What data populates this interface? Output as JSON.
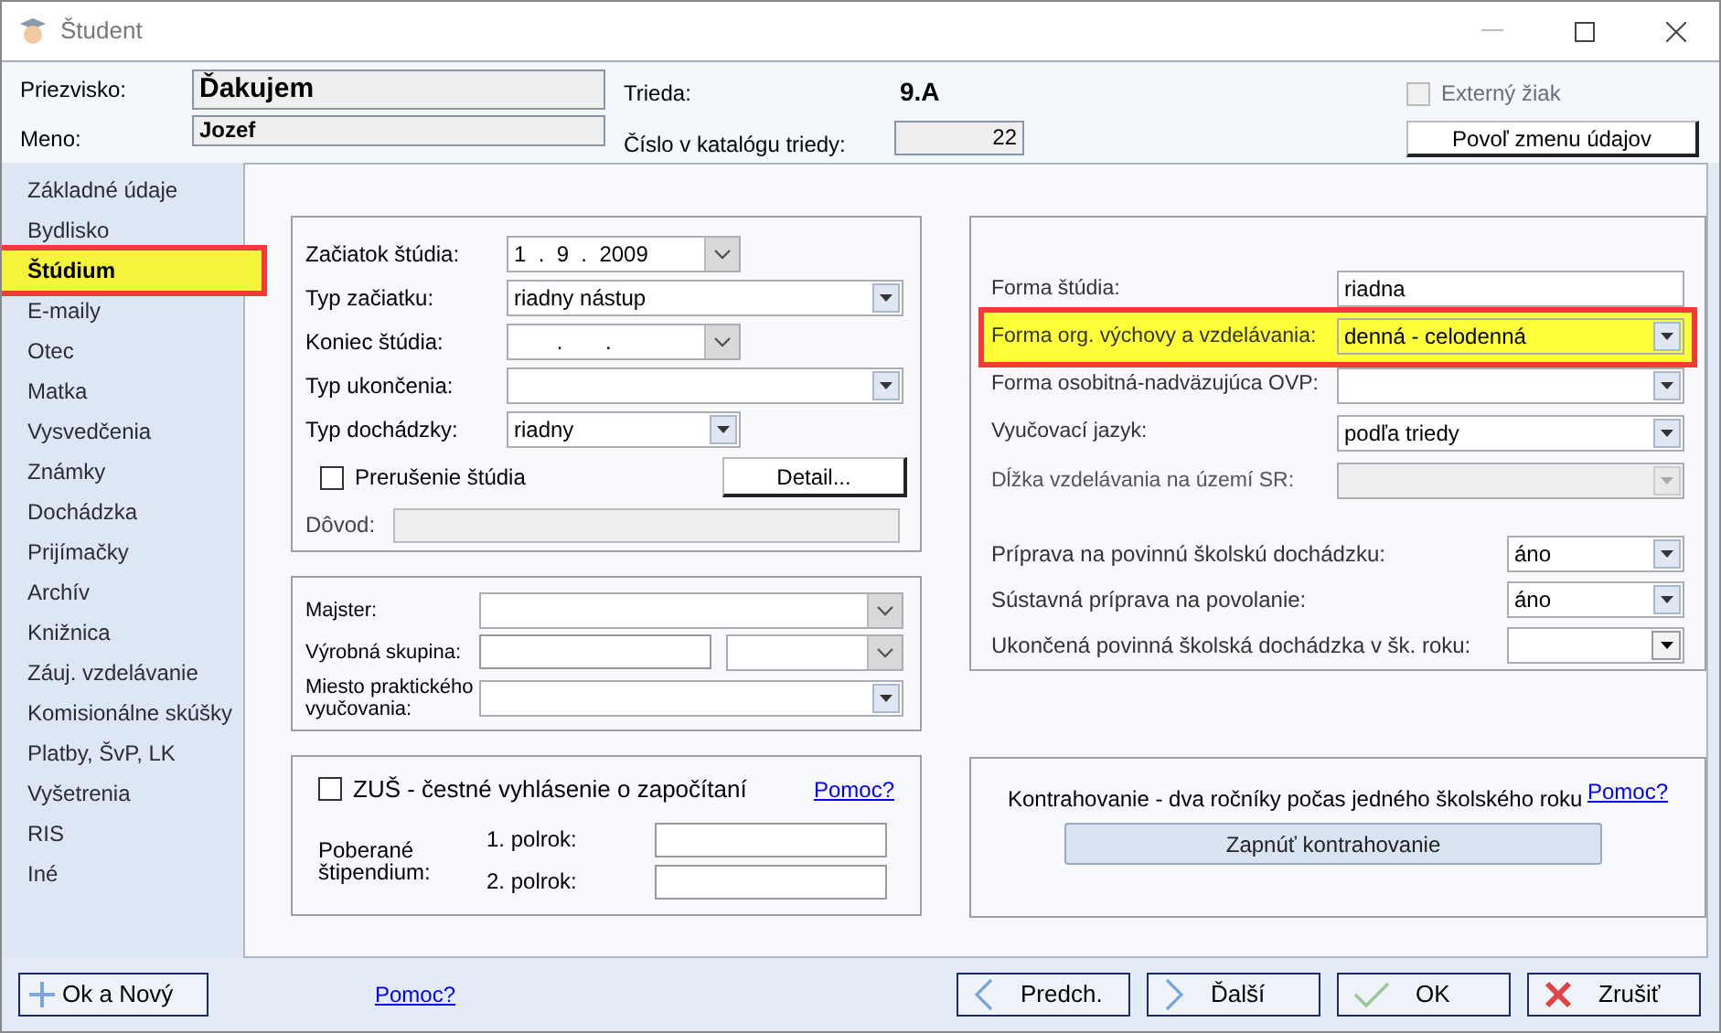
{
  "window": {
    "title": "Študent"
  },
  "header": {
    "surname_label": "Priezvisko:",
    "surname": "Ďakujem",
    "name_label": "Meno:",
    "name": "Jozef",
    "class_label": "Trieda:",
    "class": "9.A",
    "catalog_label": "Číslo v katalógu triedy:",
    "catalog_number": "22",
    "external": {
      "label": "Externý žiak",
      "checked": false,
      "disabled": true
    },
    "allow_edit_button": "Povoľ zmenu údajov"
  },
  "sidebar": {
    "items": [
      {
        "label": "Základné údaje",
        "selected": false
      },
      {
        "label": "Bydlisko",
        "selected": false
      },
      {
        "label": "Štúdium",
        "selected": true
      },
      {
        "label": "E-maily",
        "selected": false
      },
      {
        "label": "Otec",
        "selected": false
      },
      {
        "label": "Matka",
        "selected": false
      },
      {
        "label": "Vysvedčenia",
        "selected": false
      },
      {
        "label": "Známky",
        "selected": false
      },
      {
        "label": "Dochádzka",
        "selected": false
      },
      {
        "label": "Prijímačky",
        "selected": false
      },
      {
        "label": "Archív",
        "selected": false
      },
      {
        "label": "Knižnica",
        "selected": false
      },
      {
        "label": "Záuj. vzdelávanie",
        "selected": false
      },
      {
        "label": "Komisionálne skúšky",
        "selected": false
      },
      {
        "label": "Platby, ŠvP, LK",
        "selected": false
      },
      {
        "label": "Vyšetrenia",
        "selected": false
      },
      {
        "label": "RIS",
        "selected": false
      },
      {
        "label": "Iné",
        "selected": false
      }
    ]
  },
  "study_group": {
    "fields": [
      {
        "label": "Začiatok štúdia:",
        "kind": "date",
        "value": "1  .  9  .  2009"
      },
      {
        "label": "Typ začiatku:",
        "kind": "combo",
        "value": "riadny nástup"
      },
      {
        "label": "Koniec štúdia:",
        "kind": "date",
        "value": "       .       ."
      },
      {
        "label": "Typ ukončenia:",
        "kind": "combo"
      },
      {
        "label": "Typ dochádzky:",
        "kind": "combo",
        "value": "riadny"
      }
    ],
    "interruption": {
      "label": "Prerušenie štúdia",
      "checked": false
    },
    "detail_button": "Detail...",
    "reason": {
      "label": "Dôvod:"
    }
  },
  "practice_group": {
    "fields": [
      {
        "label": "Majster:",
        "kind": "date"
      },
      {
        "label": "Výrobná skupina:",
        "kind": "split"
      },
      {
        "label": "Miesto praktického vyučovania:",
        "kind": "combo"
      }
    ]
  },
  "zus_group": {
    "declaration": {
      "label": "ZUŠ - čestné vyhlásenie o započítaní",
      "checked": false
    },
    "help_link": "Pomoc?",
    "stipend_label": "Poberané štipendium:",
    "terms": [
      {
        "label": "1. polrok:"
      },
      {
        "label": "2. polrok:"
      }
    ]
  },
  "form_group": {
    "fields": [
      {
        "label": "Forma štúdia:",
        "kind": "text",
        "value": "riadna",
        "highlighted": false,
        "disabled": false
      },
      {
        "label": "Forma org. výchovy a vzdelávania:",
        "kind": "combo",
        "value": "denná - celodenná",
        "highlighted": true,
        "disabled": false
      },
      {
        "label": "Forma osobitná-nadväzujúca OVP:",
        "kind": "combo",
        "highlighted": false,
        "disabled": false
      },
      {
        "label": "Vyučovací jazyk:",
        "kind": "combo",
        "value": "podľa triedy",
        "highlighted": false,
        "disabled": false
      },
      {
        "label": "Dĺžka vzdelávania na území SR:",
        "kind": "combo",
        "highlighted": false,
        "disabled": true
      }
    ],
    "preparation_fields": [
      {
        "label": "Príprava na povinnú školskú dochádzku:",
        "kind": "combo",
        "value": "áno"
      },
      {
        "label": "Sústavná príprava na povolanie:",
        "kind": "combo",
        "value": "áno"
      },
      {
        "label": "Ukončená povinná školská dochádzka v šk. roku:",
        "kind": "combo-dark"
      }
    ]
  },
  "contract_group": {
    "text": "Kontrahovanie - dva ročníky počas jedného školského roku",
    "help_link": "Pomoc?",
    "button": "Zapnúť kontrahovanie"
  },
  "footer": {
    "ok_new": "Ok a Nový",
    "help_link": "Pomoc?",
    "buttons": [
      {
        "label": "Predch.",
        "kind": "prev"
      },
      {
        "label": "Ďalší",
        "kind": "next"
      },
      {
        "label": "OK",
        "kind": "ok"
      },
      {
        "label": "Zrušiť",
        "kind": "cancel"
      }
    ]
  }
}
